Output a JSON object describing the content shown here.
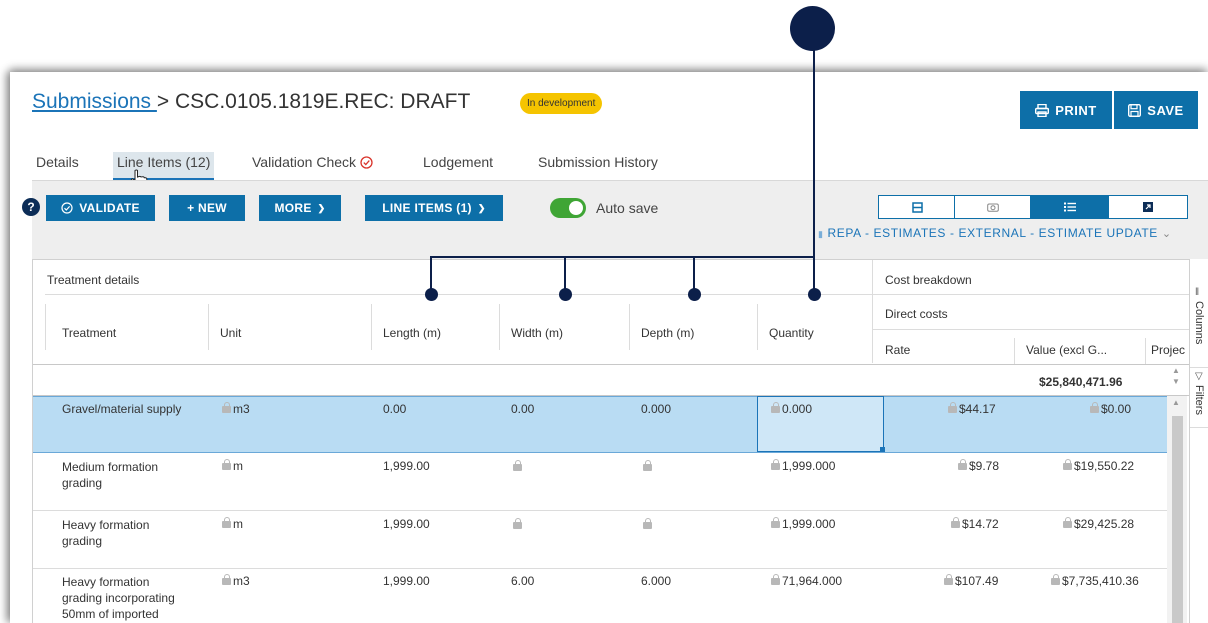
{
  "header": {
    "breadcrumb_link": "Submissions ",
    "breadcrumb_sep": ">",
    "title": "CSC.0105.1819E.REC: DRAFT",
    "status_badge": "In development",
    "print_label": "PRINT",
    "save_label": "SAVE"
  },
  "tabs": [
    {
      "label": "Details"
    },
    {
      "label": "Line Items (12)"
    },
    {
      "label": "Validation Check"
    },
    {
      "label": "Lodgement"
    },
    {
      "label": "Submission History"
    }
  ],
  "toolbar": {
    "help": "?",
    "validate": "VALIDATE",
    "new": "+ NEW",
    "more": "MORE",
    "line_items": "LINE ITEMS (1)",
    "autosave": "Auto save",
    "view_title": "REPA - ESTIMATES - EXTERNAL - ESTIMATE UPDATE"
  },
  "grid": {
    "group_treatment": "Treatment details",
    "group_cost": "Cost breakdown",
    "group_direct": "Direct costs",
    "columns": {
      "treatment": "Treatment",
      "unit": "Unit",
      "length": "Length (m)",
      "width": "Width (m)",
      "depth": "Depth (m)",
      "quantity": "Quantity",
      "rate": "Rate",
      "value": "Value (excl G...",
      "project": "Projec"
    },
    "total_value": "$25,840,471.96",
    "rows": [
      {
        "treatment": [
          "Gravel/material supply"
        ],
        "unit": "m3",
        "length": "0.00",
        "width": "0.00",
        "depth": "0.000",
        "quantity": "0.000",
        "rate": "$44.17",
        "value": "$0.00"
      },
      {
        "treatment": [
          "Medium formation",
          "grading"
        ],
        "unit": "m",
        "length": "1,999.00",
        "width": "",
        "depth": "",
        "quantity": "1,999.000",
        "rate": "$9.78",
        "value": "$19,550.22"
      },
      {
        "treatment": [
          "Heavy formation",
          "grading"
        ],
        "unit": "m",
        "length": "1,999.00",
        "width": "",
        "depth": "",
        "quantity": "1,999.000",
        "rate": "$14.72",
        "value": "$29,425.28"
      },
      {
        "treatment": [
          "Heavy formation",
          "grading incorporating",
          "50mm of imported"
        ],
        "unit": "m3",
        "length": "1,999.00",
        "width": "6.00",
        "depth": "6.000",
        "quantity": "71,964.000",
        "rate": "$107.49",
        "value": "$7,735,410.36"
      }
    ]
  },
  "side_panel": {
    "columns": "Columns",
    "filters": "Filters"
  },
  "colors": {
    "primary": "#0d6fa8",
    "link": "#1b74b8",
    "badge": "#f5c400",
    "selected_row": "#b9dcf3",
    "annotation": "#0c1f4a"
  }
}
